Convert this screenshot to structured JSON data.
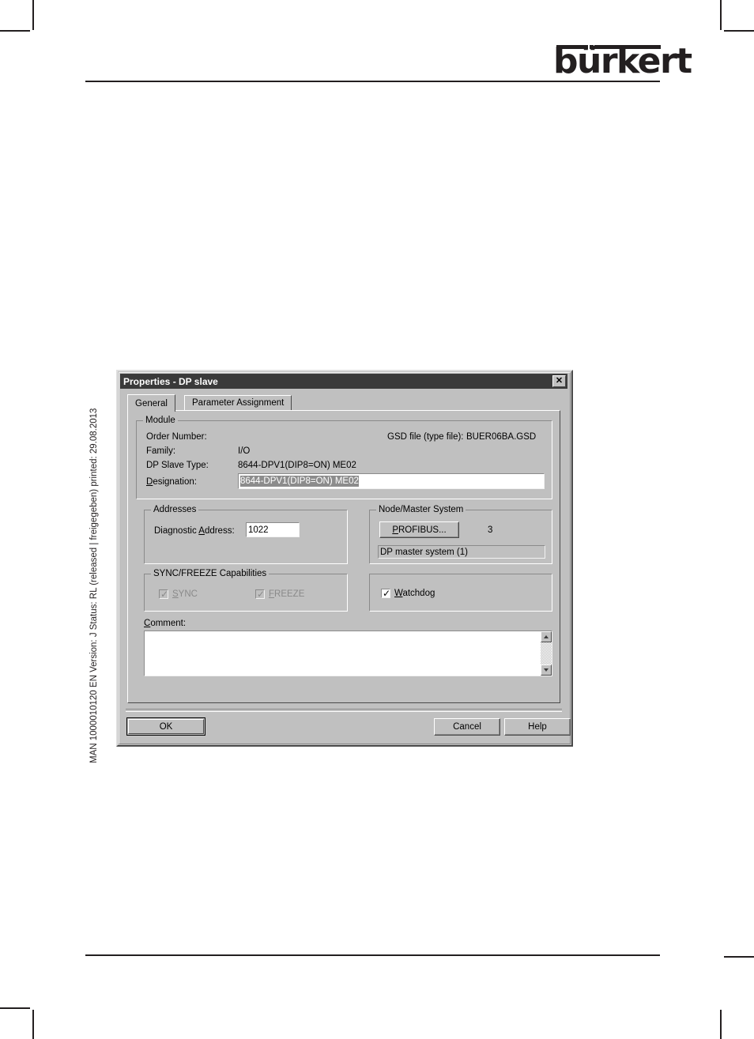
{
  "page": {
    "logo_text": "bürkert",
    "side_note": "MAN 1000010120  EN  Version: J  Status: RL (released | freigegeben)  printed: 29.08.2013"
  },
  "dialog": {
    "title": "Properties - DP slave",
    "close_label": "✕",
    "tabs": [
      {
        "label": "General",
        "active": true
      },
      {
        "label": "Parameter Assignment",
        "active": false
      }
    ],
    "module": {
      "group_label": "Module",
      "order_number_label": "Order Number:",
      "order_number_value": "",
      "gsd_label": "GSD file (type file):",
      "gsd_value": "BUER06BA.GSD",
      "family_label": "Family:",
      "family_value": "I/O",
      "dp_slave_type_label": "DP Slave Type:",
      "dp_slave_type_value": "8644-DPV1(DIP8=ON) ME02",
      "designation_label": "Designation:",
      "designation_value": "8644-DPV1(DIP8=ON) ME02"
    },
    "addresses": {
      "group_label": "Addresses",
      "diagnostic_address_label": "Diagnostic Address:",
      "diagnostic_address_value": "1022"
    },
    "node_master_system": {
      "group_label": "Node/Master System",
      "profibus_button": "PROFIBUS...",
      "node_number": "3",
      "master_system_value": "DP master system (1)"
    },
    "sync_freeze": {
      "group_label": "SYNC/FREEZE Capabilities",
      "sync_label": "SYNC",
      "sync_checked": true,
      "sync_enabled": false,
      "freeze_label": "FREEZE",
      "freeze_checked": true,
      "freeze_enabled": false
    },
    "watchdog": {
      "label": "Watchdog",
      "checked": true
    },
    "comment": {
      "label": "Comment:",
      "value": ""
    },
    "buttons": {
      "ok": "OK",
      "cancel": "Cancel",
      "help": "Help"
    },
    "colors": {
      "face": "#c0c0c0",
      "titlebar": "#3a3a3a",
      "selection": "#8c8c8c",
      "ink": "#231f20"
    }
  }
}
